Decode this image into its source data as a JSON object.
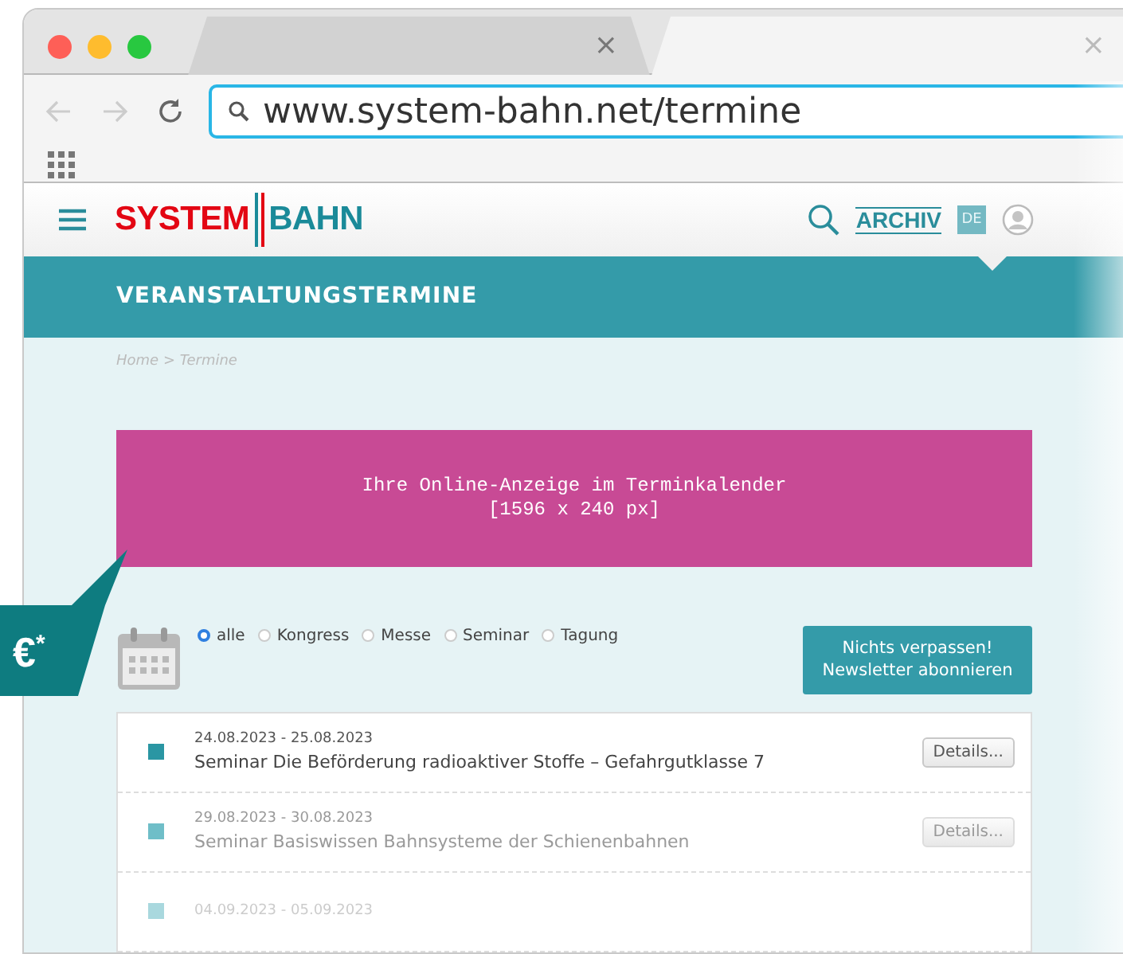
{
  "browser": {
    "tabs": [
      {
        "close": "×",
        "selected": false
      },
      {
        "close": "×",
        "selected": true
      }
    ],
    "url": "www.system-bahn.net/termine"
  },
  "header": {
    "logo": {
      "left": "SYSTEM",
      "right": "BAHN"
    },
    "archive": "ARCHIV",
    "language": "DE"
  },
  "banner": {
    "title": "VERANSTALTUNGSTERMINE"
  },
  "breadcrumb": "Home > Termine",
  "ad": {
    "lines": [
      "Ihre Online-Anzeige im Terminkalender",
      "[1596 x 240 px]"
    ]
  },
  "price_badge": "€$^{*}$",
  "filters": [
    {
      "label": "alle",
      "selected": true
    },
    {
      "label": "Kongress",
      "selected": false
    },
    {
      "label": "Messe",
      "selected": false
    },
    {
      "label": "Seminar",
      "selected": false
    },
    {
      "label": "Tagung",
      "selected": false
    }
  ],
  "newsletter_button": [
    "Nichts verpassen!",
    "Newsletter abonnieren"
  ],
  "events": [
    {
      "date": "24.08.2023 - 25.08.2023",
      "title": "Seminar Die Beförderung radioaktiver Stoffe – Gefahrgutklasse 7",
      "button": "Details...",
      "color": "#2a96a3",
      "dimmed": false
    },
    {
      "date": "29.08.2023 - 30.08.2023",
      "title": "Seminar Basiswissen Bahnsysteme der Schienenbahnen",
      "button": "Details...",
      "color": "#6fbec8",
      "dimmed": true
    },
    {
      "date": "04.09.2023 - 05.09.2023",
      "dimmed": true,
      "color": "#a9d8de"
    }
  ]
}
